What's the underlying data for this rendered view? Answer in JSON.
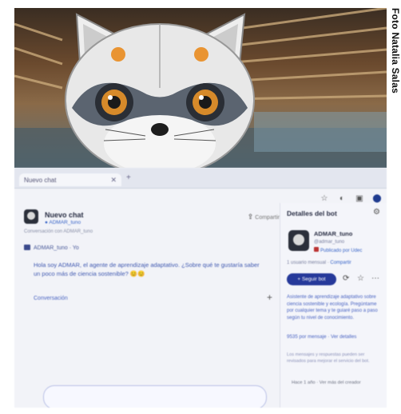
{
  "photo": {
    "credit": "Foto Natalia Salas",
    "icon": "raccoon-mascot"
  },
  "browser": {
    "tab_label": "Nuevo chat",
    "tab_close_icon": "close-icon",
    "new_tab_icon": "plus-icon"
  },
  "toolbar": {
    "icons": [
      "star-icon",
      "circle-icon",
      "sidebar-icon",
      "account-icon"
    ]
  },
  "chat": {
    "title": "Nuevo chat",
    "subtitle": "● ADMAR_tuno",
    "subtitle2": "Conversación con ADMAR_tuno",
    "share_label": "Compartir",
    "user_name": "ADMAR_tuno · Yo",
    "message": "Hola soy ADMAR, el agente de aprendizaje adaptativo. ¿Sobre qué te gustaría saber un poco más de ciencia sostenible? 😊😊",
    "conversation_link": "Conversación",
    "add_icon": "plus-icon"
  },
  "details": {
    "title": "Detalles del bot",
    "gear_icon": "gear-icon",
    "bot_name": "ADMAR_tuno",
    "bot_handle": "@admar_tuno",
    "owner": "Publicado por Udec",
    "meta_prefix": "1 usuario mensual ·",
    "meta_link": "Compartir",
    "follow_label": "+ Seguir bot",
    "action_icons": [
      "sync-icon",
      "star-icon",
      "more-icon"
    ],
    "description": "Asistente de aprendizaje adaptativo sobre ciencia sostenible y ecología. Pregúntame por cualquier tema y te guiaré paso a paso según tu nivel de conocimiento.",
    "stat_prefix": "9535 por mensaje ·",
    "stat_link": "Ver detalles",
    "note": "Los mensajes y respuestas pueden ser revisados para mejorar el servicio del bot.",
    "footer": "Hace 1 año · Ver más del creador"
  }
}
